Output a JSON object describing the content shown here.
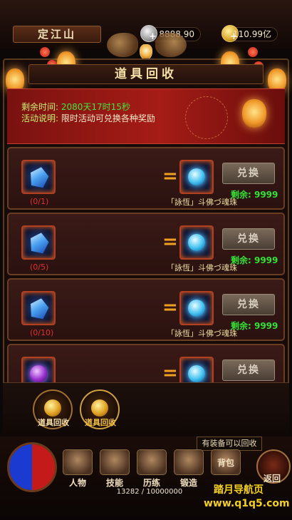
{
  "top": {
    "title": "定江山",
    "silver": "8888.90",
    "gold": "110.99亿"
  },
  "header": {
    "title": "道具回收"
  },
  "info": {
    "time_label": "剩余时间:",
    "time_value": "2080天17时15秒",
    "desc_label": "活动说明:",
    "desc_value": "限时活动可兑换各种奖励"
  },
  "items": [
    {
      "req": "(0/1)",
      "reward": "「詠恆」斗佛づ魂珠",
      "button": "兑换",
      "remaining": "剩余: 9999"
    },
    {
      "req": "(0/5)",
      "reward": "「詠恆」斗佛づ魂珠",
      "button": "兑换",
      "remaining": "剩余: 9999"
    },
    {
      "req": "(0/10)",
      "reward": "「詠恆」斗佛づ魂珠",
      "button": "兑换",
      "remaining": "剩余: 9999"
    },
    {
      "req": "",
      "reward": "",
      "button": "兑换",
      "remaining": ""
    }
  ],
  "tabs": [
    {
      "label": "道具回收"
    },
    {
      "label": "道具回收"
    }
  ],
  "hint": "有装备可以回收",
  "nav": [
    {
      "label": "人物"
    },
    {
      "label": "技能"
    },
    {
      "label": "历练"
    },
    {
      "label": "锻造"
    },
    {
      "label": "背包"
    }
  ],
  "back_label": "返回",
  "exp": "13282 / 10000000",
  "watermark": {
    "line1": "踏月导航页",
    "line2": "www.q1q5.com"
  }
}
